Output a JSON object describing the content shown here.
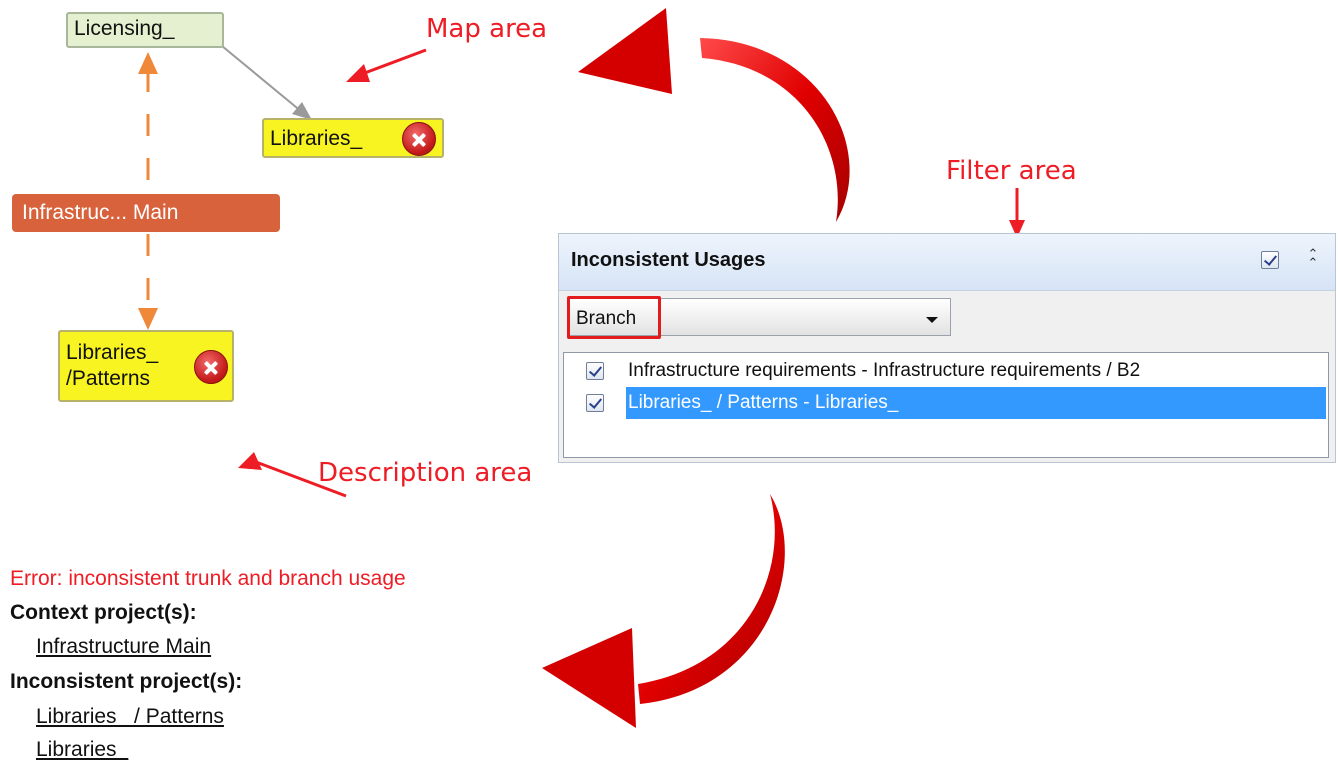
{
  "map": {
    "nodes": {
      "licensing": "Licensing_",
      "libraries": "Libraries_",
      "infrastructure": "Infrastruc... Main",
      "libraries_patterns_line1": "Libraries_",
      "libraries_patterns_line2": "/Patterns"
    }
  },
  "callouts": {
    "map_area": "Map area",
    "filter_area": "Filter area",
    "description_area": "Description area"
  },
  "filter_panel": {
    "title": "Inconsistent Usages",
    "filter_checked": true,
    "combo_value": "Branch",
    "rows": [
      {
        "label": "Infrastructure requirements - Infrastructure requirements / B2",
        "checked": true,
        "selected": false
      },
      {
        "label": "Libraries_ / Patterns - Libraries_",
        "checked": true,
        "selected": true
      }
    ]
  },
  "description": {
    "error": "Error: inconsistent trunk and branch usage",
    "context_heading": "Context project(s):",
    "context_projects": [
      "Infrastructure Main"
    ],
    "inconsistent_heading": "Inconsistent project(s):",
    "inconsistent_projects": [
      "Libraries_ / Patterns",
      "Libraries_"
    ]
  },
  "colors": {
    "callout_red": "#ee1c24",
    "node_yellow": "#f7f422",
    "node_green": "#e4f0d0",
    "node_orange": "#d8623c",
    "selection_blue": "#3399ff"
  }
}
